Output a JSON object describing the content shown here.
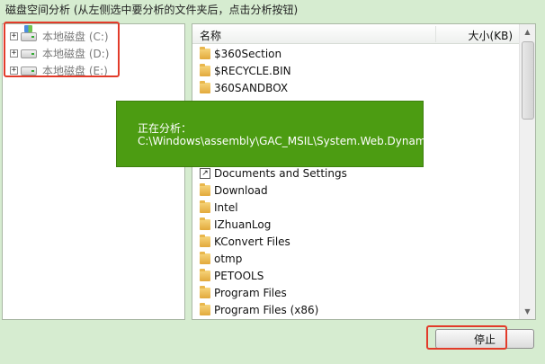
{
  "window": {
    "title": "磁盘空间分析 (从左侧选中要分析的文件夹后，点击分析按钮)"
  },
  "tree": {
    "items": [
      {
        "label": "本地磁盘 (C:)",
        "icon": "system-drive-icon"
      },
      {
        "label": "本地磁盘 (D:)",
        "icon": "drive-icon"
      },
      {
        "label": "本地磁盘 (E:)",
        "icon": "drive-icon"
      }
    ],
    "expander": "+"
  },
  "list": {
    "columns": {
      "name": "名称",
      "size": "大小(KB)"
    },
    "rows": [
      {
        "name": "$360Section",
        "icon": "folder-icon"
      },
      {
        "name": "$RECYCLE.BIN",
        "icon": "folder-icon"
      },
      {
        "name": "360SANDBOX",
        "icon": "folder-icon"
      },
      {
        "name": "Documents and Settings",
        "icon": "shortcut-folder-icon"
      },
      {
        "name": "Download",
        "icon": "folder-icon"
      },
      {
        "name": "Intel",
        "icon": "folder-icon"
      },
      {
        "name": "IZhuanLog",
        "icon": "folder-icon"
      },
      {
        "name": "KConvert Files",
        "icon": "folder-icon"
      },
      {
        "name": "otmp",
        "icon": "folder-icon"
      },
      {
        "name": "PETOOLS",
        "icon": "folder-icon"
      },
      {
        "name": "Program Files",
        "icon": "folder-icon"
      },
      {
        "name": "Program Files (x86)",
        "icon": "folder-icon"
      }
    ]
  },
  "progress": {
    "title": "正在分析：",
    "path": "C:\\Windows\\assembly\\GAC_MSIL\\System.Web.Dynami"
  },
  "buttons": {
    "stop": "停止"
  },
  "colors": {
    "background": "#d6ecd0",
    "popup": "#4c9c12",
    "highlight_box": "#e23b2a"
  }
}
